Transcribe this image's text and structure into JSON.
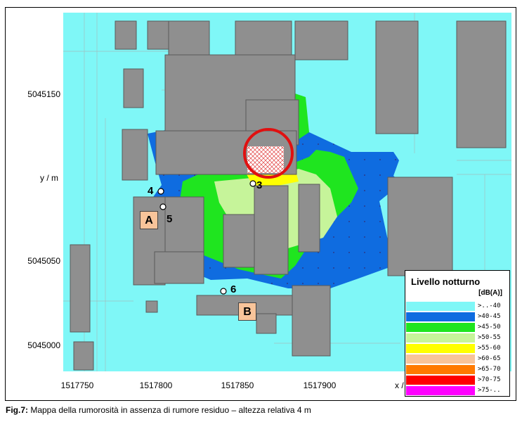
{
  "caption": {
    "prefix": "Fig.7:",
    "text": " Mappa della rumorosità in assenza di rumore residuo – altezza relativa 4 m"
  },
  "axes": {
    "y_label": "y / m",
    "x_label": "x / m",
    "y_ticks": [
      "5045150",
      "5045050",
      "5045000"
    ],
    "x_ticks": [
      "1517750",
      "1517800",
      "1517850",
      "1517900"
    ]
  },
  "legend": {
    "title": "Livello notturno",
    "unit": "[dB(A)]",
    "classes": [
      {
        "label": ">..-40",
        "color": "#7ff7f7"
      },
      {
        "label": ">40-45",
        "color": "#0f6ce0"
      },
      {
        "label": ">45-50",
        "color": "#1fe51f"
      },
      {
        "label": ">50-55",
        "color": "#c6f49a"
      },
      {
        "label": ">55-60",
        "color": "#ffff00"
      },
      {
        "label": ">60-65",
        "color": "#f8c49a"
      },
      {
        "label": ">65-70",
        "color": "#ff7a00"
      },
      {
        "label": ">70-75",
        "color": "#ff0000"
      },
      {
        "label": ">75-..",
        "color": "#ff00ff"
      }
    ]
  },
  "sites": [
    {
      "label": "A"
    },
    {
      "label": "B"
    }
  ],
  "points": [
    "3",
    "4",
    "5",
    "6"
  ],
  "colors": {
    "building": "#8f8f8f",
    "highlight_circle": "#e01010"
  }
}
